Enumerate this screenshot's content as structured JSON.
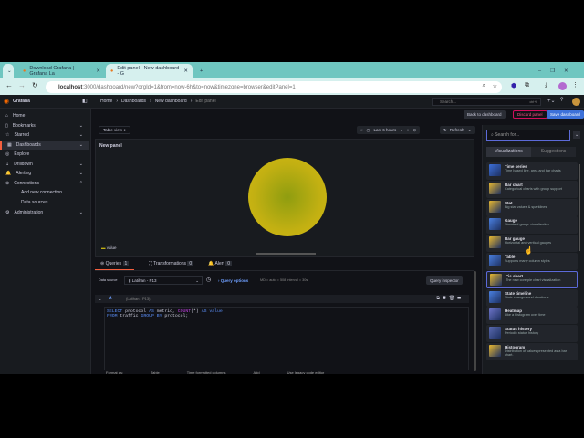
{
  "browser": {
    "tabs": [
      {
        "label": "Download Grafana | Grafana La"
      },
      {
        "label": "Edit panel - New dashboard - G"
      }
    ],
    "url_host": "localhost",
    "url_rest": ":3000/dashboard/new?orgId=1&from=now-6h&to=now&timezone=browser&editPanel=1"
  },
  "topbar": {
    "logo": "Grafana",
    "breadcrumb": [
      "Home",
      "Dashboards",
      "New dashboard",
      "Edit panel"
    ],
    "search_placeholder": "Search...",
    "shortcut": "ctrl+k"
  },
  "sidebar": {
    "items": [
      {
        "label": "Home"
      },
      {
        "label": "Bookmarks"
      },
      {
        "label": "Starred"
      },
      {
        "label": "Dashboards"
      },
      {
        "label": "Explore"
      },
      {
        "label": "Drilldown"
      },
      {
        "label": "Alerting"
      },
      {
        "label": "Connections"
      },
      {
        "label": "Add new connection"
      },
      {
        "label": "Data sources"
      },
      {
        "label": "Administration"
      }
    ]
  },
  "actions": {
    "back": "Back to dashboard",
    "discard": "Discard panel",
    "save": "Save dashboard"
  },
  "toolbar": {
    "table_view": "Table view",
    "time_range": "Last 6 hours",
    "refresh": "Refresh"
  },
  "panel": {
    "title": "New panel",
    "legend": "value"
  },
  "chart_data": {
    "type": "pie",
    "categories": [
      "value"
    ],
    "values": [
      1
    ],
    "title": "New panel",
    "colors": [
      "#c2b012"
    ]
  },
  "query": {
    "tabs": [
      {
        "label": "Queries",
        "count": "1"
      },
      {
        "label": "Transformations",
        "count": "0"
      },
      {
        "label": "Alert",
        "count": "0"
      }
    ],
    "ds_label": "Data source",
    "ds_value": "Latihan - P13",
    "options": "Query options",
    "options_meta": "MD = auto = 508   Interval = 30s",
    "inspector": "Query inspector",
    "ref": "A",
    "ref_ds": "(Latihan - P13)",
    "line1": [
      "SELECT",
      " protocol ",
      "AS",
      " metric, ",
      "COUNT",
      "(*) ",
      "AS",
      " value"
    ],
    "line2": [
      "FROM",
      " traffic ",
      "GROUP BY",
      " protocol;"
    ],
    "footer": [
      "Format as:",
      "Table",
      "Time formatted columns",
      "Add",
      "Use legacy code editor"
    ]
  },
  "viz": {
    "search_placeholder": "Search for...",
    "tabs": [
      "Visualizations",
      "Suggestions"
    ],
    "items": [
      {
        "t": "Time series",
        "d": "Time based line, area and bar charts"
      },
      {
        "t": "Bar chart",
        "d": "Categorical charts with group support"
      },
      {
        "t": "Stat",
        "d": "Big stat values & sparklines"
      },
      {
        "t": "Gauge",
        "d": "Standard gauge visualization"
      },
      {
        "t": "Bar gauge",
        "d": "Horizontal and vertical gauges"
      },
      {
        "t": "Table",
        "d": "Supports many column styles"
      },
      {
        "t": "Pie chart",
        "d": "The new core pie chart visualization"
      },
      {
        "t": "State timeline",
        "d": "State changes and durations"
      },
      {
        "t": "Heatmap",
        "d": "Like a histogram over time"
      },
      {
        "t": "Status history",
        "d": "Periodic status history"
      },
      {
        "t": "Histogram",
        "d": "Distribution of values presented as a bar chart."
      }
    ]
  }
}
